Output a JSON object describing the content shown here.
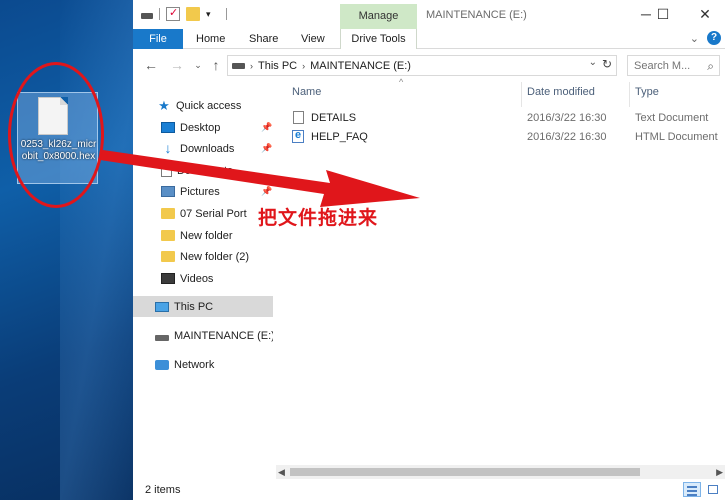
{
  "desktop": {
    "file_name": "0253_kl26z_microbit_0x8000.hex"
  },
  "annotation": {
    "text": "把文件拖进来",
    "color": "#e0161b"
  },
  "titlebar": {
    "manage_tab": "Manage",
    "title": "MAINTENANCE (E:)",
    "minimize": "─",
    "maximize": "☐",
    "close": "✕"
  },
  "ribbon": {
    "tabs": [
      "File",
      "Home",
      "Share",
      "View",
      "Drive Tools"
    ],
    "accent": "#1979ca",
    "help": "?"
  },
  "address": {
    "crumbs": [
      "This PC",
      "MAINTENANCE (E:)"
    ],
    "search_placeholder": "Search M..."
  },
  "nav": {
    "items": [
      {
        "label": "Quick access"
      },
      {
        "label": "Desktop"
      },
      {
        "label": "Downloads"
      },
      {
        "label": "Documents"
      },
      {
        "label": "Pictures"
      },
      {
        "label": "07 Serial Port"
      },
      {
        "label": "New folder"
      },
      {
        "label": "New folder (2)"
      },
      {
        "label": "Videos"
      },
      {
        "label": "This PC"
      },
      {
        "label": "MAINTENANCE (E:)"
      },
      {
        "label": "Network"
      }
    ]
  },
  "columns": {
    "name": "Name",
    "date": "Date modified",
    "type": "Type"
  },
  "files": [
    {
      "name": "DETAILS",
      "date": "2016/3/22 16:30",
      "type": "Text Document"
    },
    {
      "name": "HELP_FAQ",
      "date": "2016/3/22 16:30",
      "type": "HTML Document"
    }
  ],
  "status": {
    "items_count": "2 items"
  }
}
